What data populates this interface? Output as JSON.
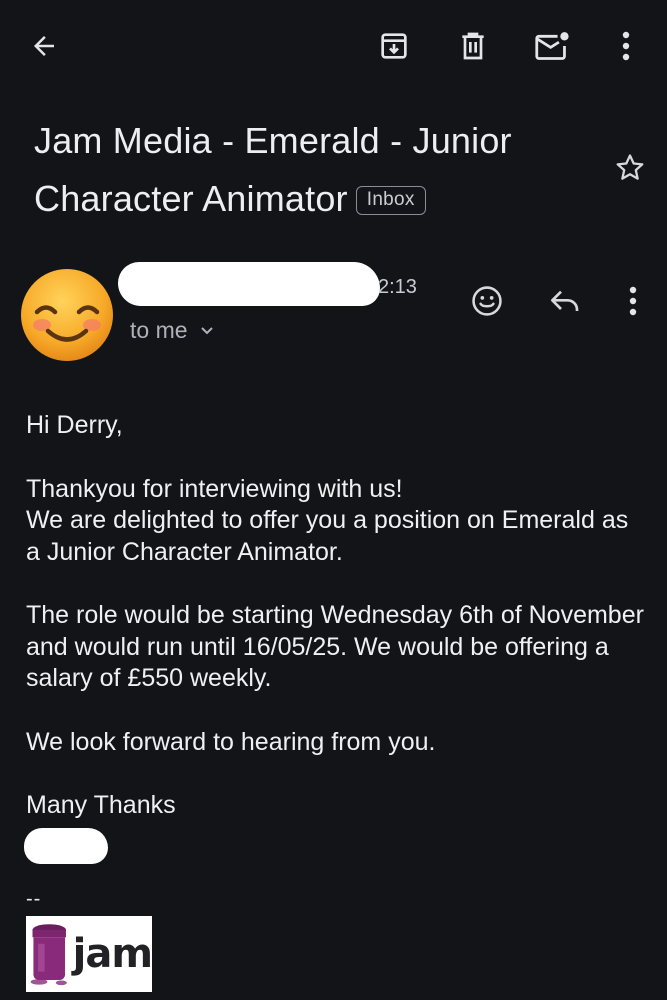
{
  "toolbar": {
    "icons": [
      "back-arrow-icon",
      "archive-icon",
      "delete-icon",
      "mark-unread-icon",
      "more-vert-icon"
    ]
  },
  "email": {
    "subject": "Jam Media - Emerald - Junior Character Animator",
    "label": "Inbox",
    "sender": {
      "avatar_emoji": "😊",
      "time_visible": "2:13",
      "recipient": "to me"
    },
    "body": {
      "greeting": "Hi Derry,",
      "para1_line1": "Thankyou for interviewing with us!",
      "para1_line2": "We are delighted to offer you a position on Emerald as a Junior Character Animator.",
      "para2": "The role would be starting Wednesday 6th of November and would run until 16/05/25. We would be offering a salary of £550 weekly.",
      "para3": "We look forward to hearing from you.",
      "closing": "Many Thanks",
      "signature_separator": "--"
    },
    "signature_logo_text": "jam"
  },
  "colors": {
    "background": "#121418",
    "text": "#eef0f2",
    "muted": "#aeb2b8",
    "logo_jar": "#8a2a7a"
  }
}
